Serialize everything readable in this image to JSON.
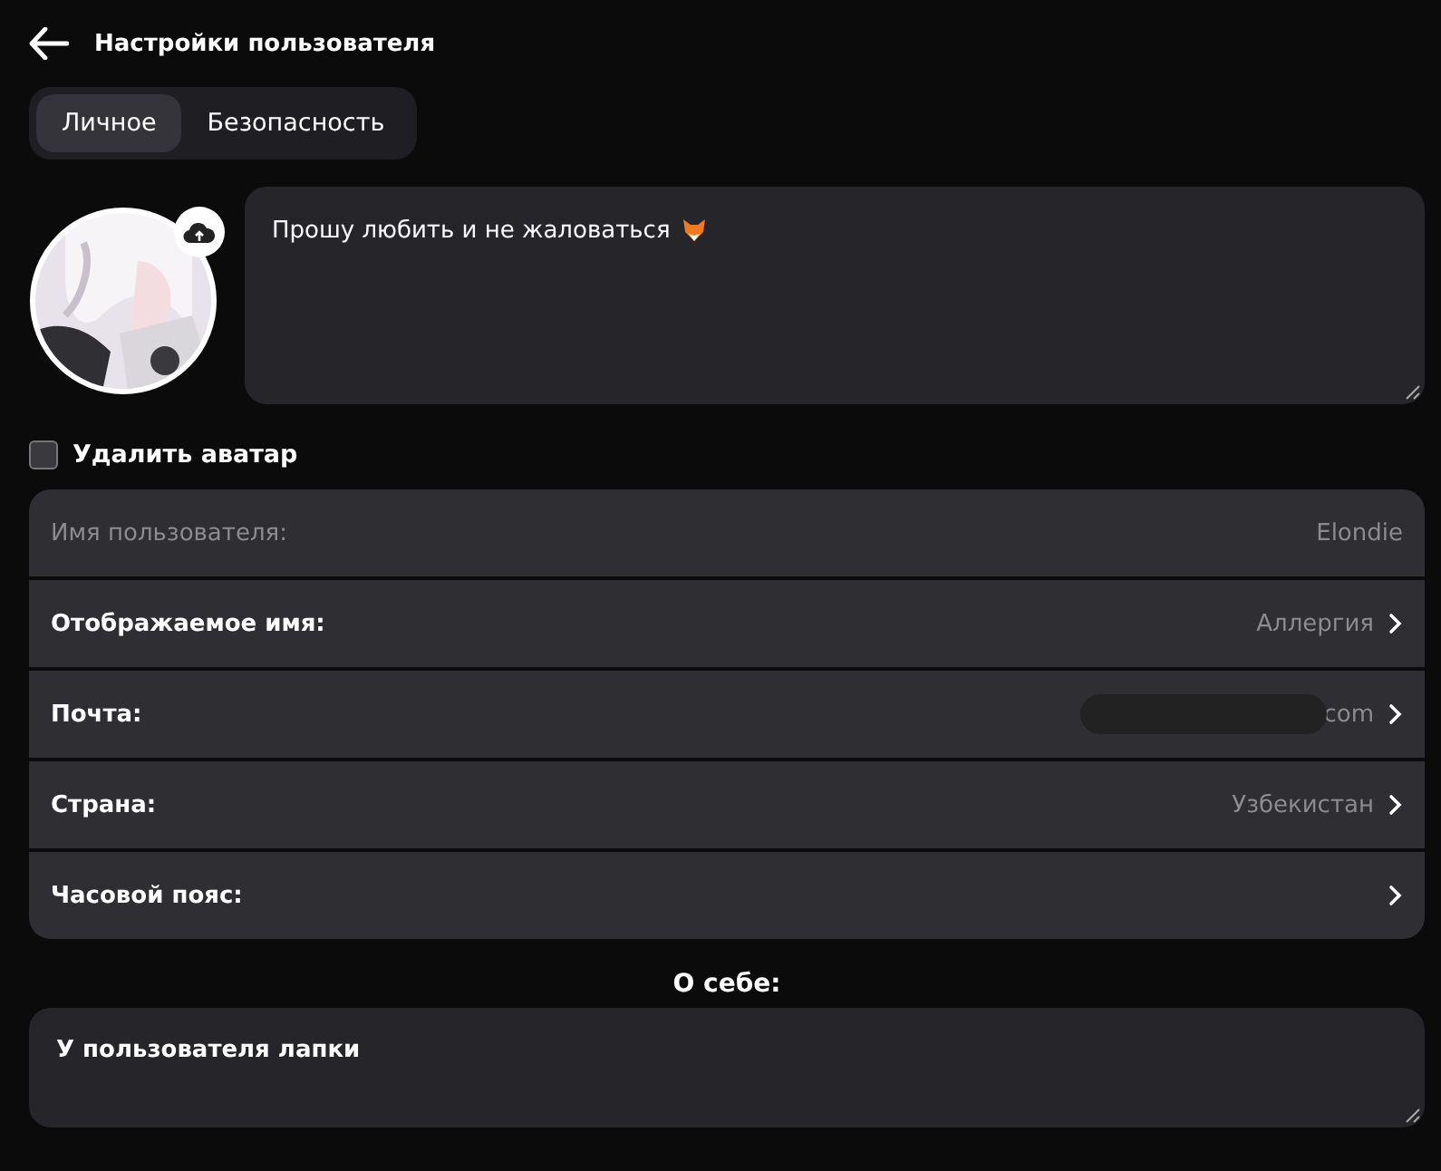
{
  "header": {
    "title": "Настройки пользователя"
  },
  "tabs": [
    {
      "label": "Личное",
      "selected": true
    },
    {
      "label": "Безопасность",
      "selected": false
    }
  ],
  "status": {
    "value": "Прошу любить и не жаловаться"
  },
  "delete_avatar": {
    "label": "Удалить аватар",
    "checked": false
  },
  "fields": [
    {
      "label": "Имя пользователя:",
      "value": "Elondie",
      "disabled": true
    },
    {
      "label": "Отображаемое имя:",
      "value": "Аллергия",
      "disabled": false
    },
    {
      "label": "Почта:",
      "value": "com",
      "disabled": false,
      "redacted": true
    },
    {
      "label": "Страна:",
      "value": "Узбекистан",
      "disabled": false
    },
    {
      "label": "Часовой пояс:",
      "disabled": false
    }
  ],
  "about": {
    "heading": "О себе:",
    "value": "У пользователя лапки"
  }
}
